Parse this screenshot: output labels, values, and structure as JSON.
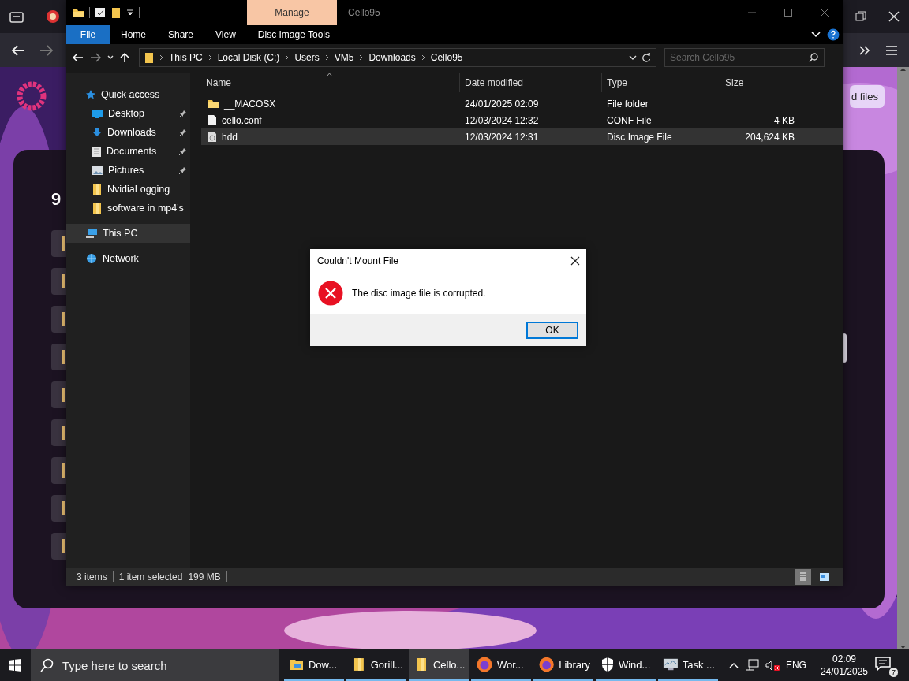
{
  "browser": {
    "page": {
      "count_fragment": "9",
      "button": "d files"
    }
  },
  "explorer": {
    "context_tab": "Manage",
    "title": "Cello95",
    "ribbon_tabs": [
      {
        "label": "File",
        "kind": "file"
      },
      {
        "label": "Home",
        "kind": "tab"
      },
      {
        "label": "Share",
        "kind": "tab"
      },
      {
        "label": "View",
        "kind": "tab"
      },
      {
        "label": "Disc Image Tools",
        "kind": "tab"
      }
    ],
    "breadcrumbs": [
      "This PC",
      "Local Disk (C:)",
      "Users",
      "VM5",
      "Downloads",
      "Cello95"
    ],
    "search": {
      "placeholder": "Search Cello95"
    },
    "nav": [
      {
        "label": "Quick access",
        "kind": "star",
        "selected": false,
        "children": [
          {
            "label": "Desktop",
            "kind": "desktop",
            "pinned": true,
            "selected": false
          },
          {
            "label": "Downloads",
            "kind": "download",
            "pinned": true,
            "selected": false
          },
          {
            "label": "Documents",
            "kind": "document",
            "pinned": true,
            "selected": false
          },
          {
            "label": "Pictures",
            "kind": "picture",
            "pinned": true,
            "selected": false
          },
          {
            "label": "NvidiaLogging",
            "kind": "folder",
            "pinned": false,
            "selected": false
          },
          {
            "label": "software in mp4's",
            "kind": "folder",
            "pinned": false,
            "selected": false
          }
        ]
      },
      {
        "label": "This PC",
        "kind": "pc",
        "selected": true
      },
      {
        "label": "Network",
        "kind": "network",
        "selected": false
      }
    ],
    "columns": [
      "Name",
      "Date modified",
      "Type",
      "Size"
    ],
    "rows": [
      {
        "name": "__MACOSX",
        "date": "24/01/2025 02:09",
        "type": "File folder",
        "kind": "folder",
        "selected": false
      },
      {
        "name": "cello.conf",
        "date": "12/03/2024 12:32",
        "type": "CONF File",
        "size": "4 KB",
        "kind": "file",
        "selected": false
      },
      {
        "name": "hdd",
        "date": "12/03/2024 12:31",
        "type": "Disc Image File",
        "size": "204,624 KB",
        "kind": "disc",
        "selected": true
      }
    ],
    "status": {
      "items": "3 items",
      "selection": "1 item selected",
      "size": "199 MB"
    },
    "views": [
      {
        "kind": "details",
        "selected": true
      },
      {
        "kind": "tiles",
        "selected": false
      }
    ]
  },
  "dialog": {
    "title": "Couldn't Mount File",
    "kind": "error",
    "message": "The disc image file is corrupted.",
    "buttons": [
      {
        "label": "OK",
        "default": true
      }
    ]
  },
  "taskbar": {
    "search": {
      "placeholder": "Type here to search"
    },
    "items": [
      {
        "label": "Dow...",
        "kind": "explorer",
        "active": false
      },
      {
        "label": "Gorill...",
        "kind": "folder",
        "active": false
      },
      {
        "label": "Cello...",
        "kind": "folder",
        "active": true
      },
      {
        "label": "Wor...",
        "kind": "firefox",
        "active": false
      },
      {
        "label": "Library",
        "kind": "firefox",
        "active": false
      },
      {
        "label": "Wind...",
        "kind": "shield",
        "active": false
      },
      {
        "label": "Task ...",
        "kind": "taskmgr",
        "active": false
      }
    ],
    "tray": {
      "language": "ENG",
      "time": "02:09",
      "date": "24/01/2025",
      "notifications": "7",
      "volume_muted": true
    }
  }
}
